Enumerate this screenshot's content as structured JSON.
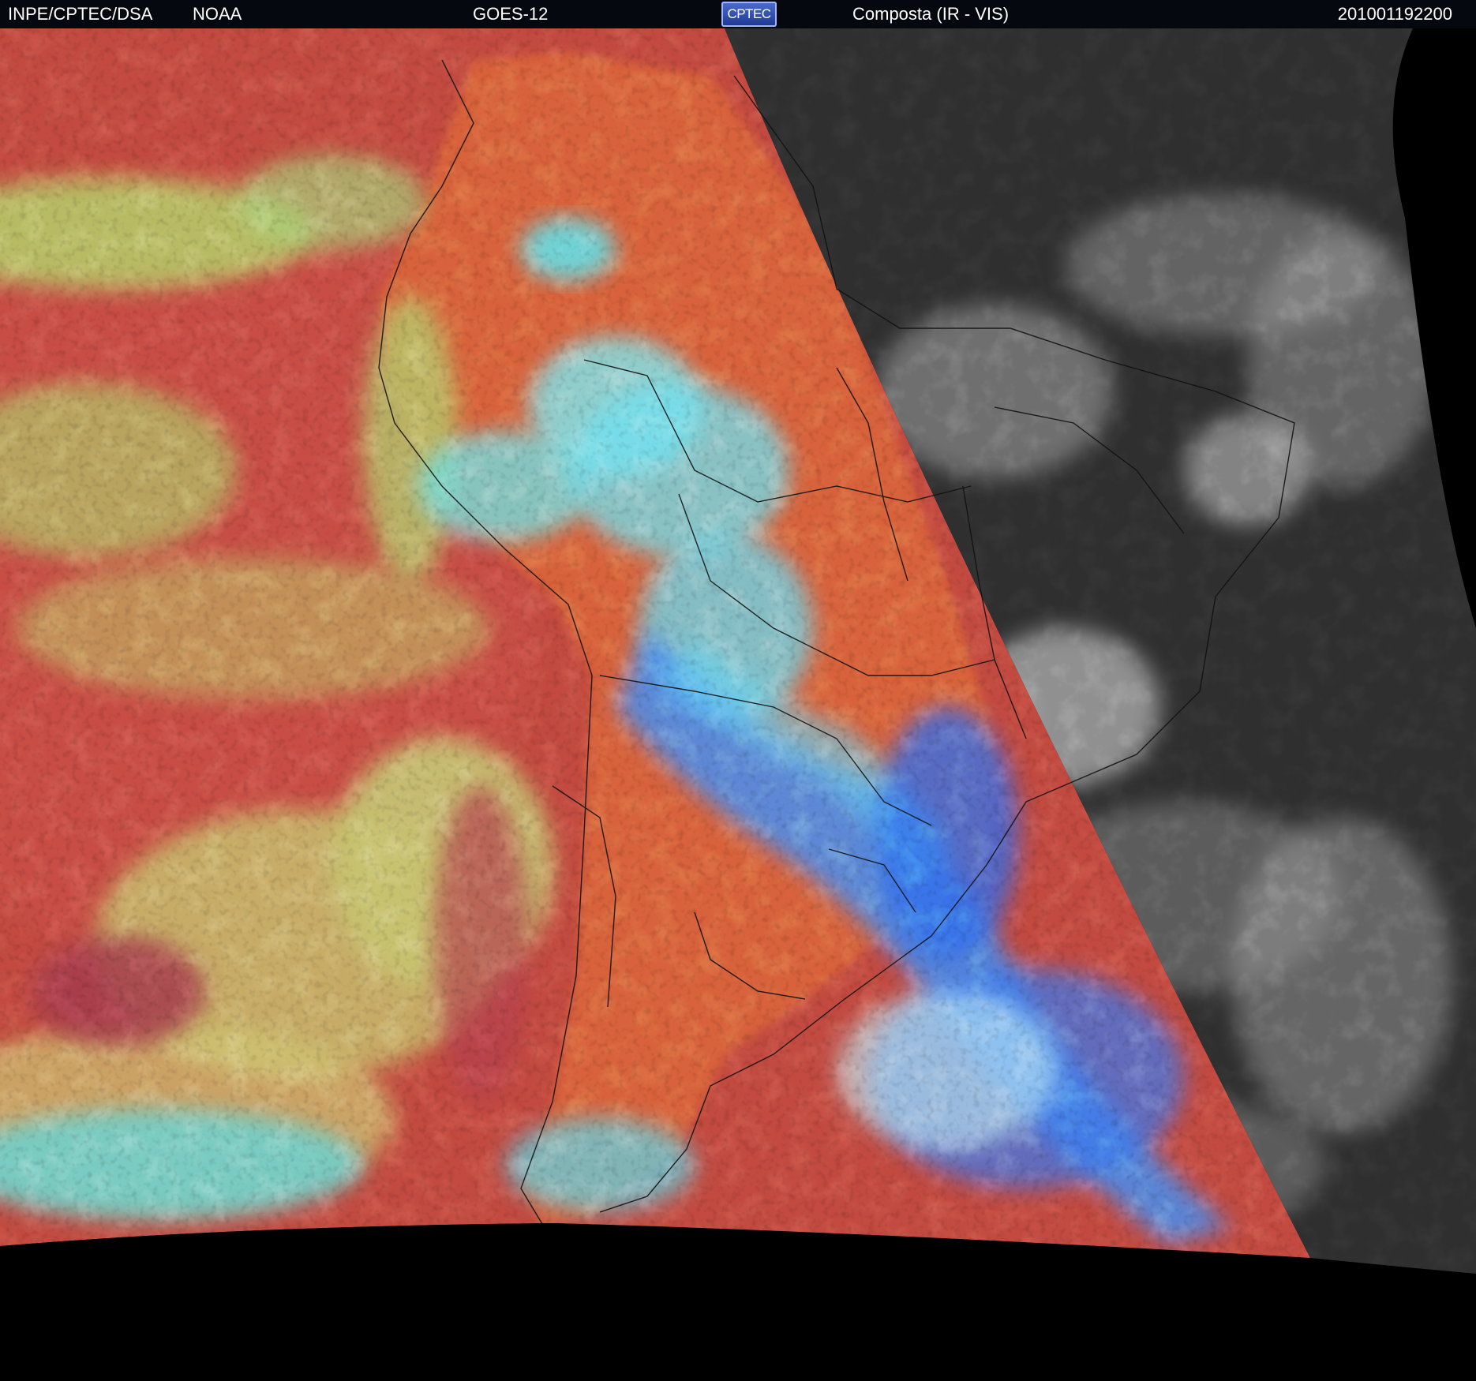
{
  "header": {
    "institution": "INPE/CPTEC/DSA",
    "agency": "NOAA",
    "satellite": "GOES-12",
    "logo_text": "CPTEC",
    "product": "Composta (IR - VIS)",
    "timestamp": "201001192200"
  },
  "image": {
    "description_icon": "satellite-composite-south-america",
    "colors": {
      "ir_background": "#c0463e",
      "ir_low_cloud": "#b8d26a",
      "ir_high_cloud": "#4fe3f0",
      "ir_deep_cloud": "#3a6ef0",
      "vis_background": "#2e2e2e",
      "vis_cloud": "#c8c8c8",
      "space": "#000000",
      "borders": "#111111"
    }
  }
}
